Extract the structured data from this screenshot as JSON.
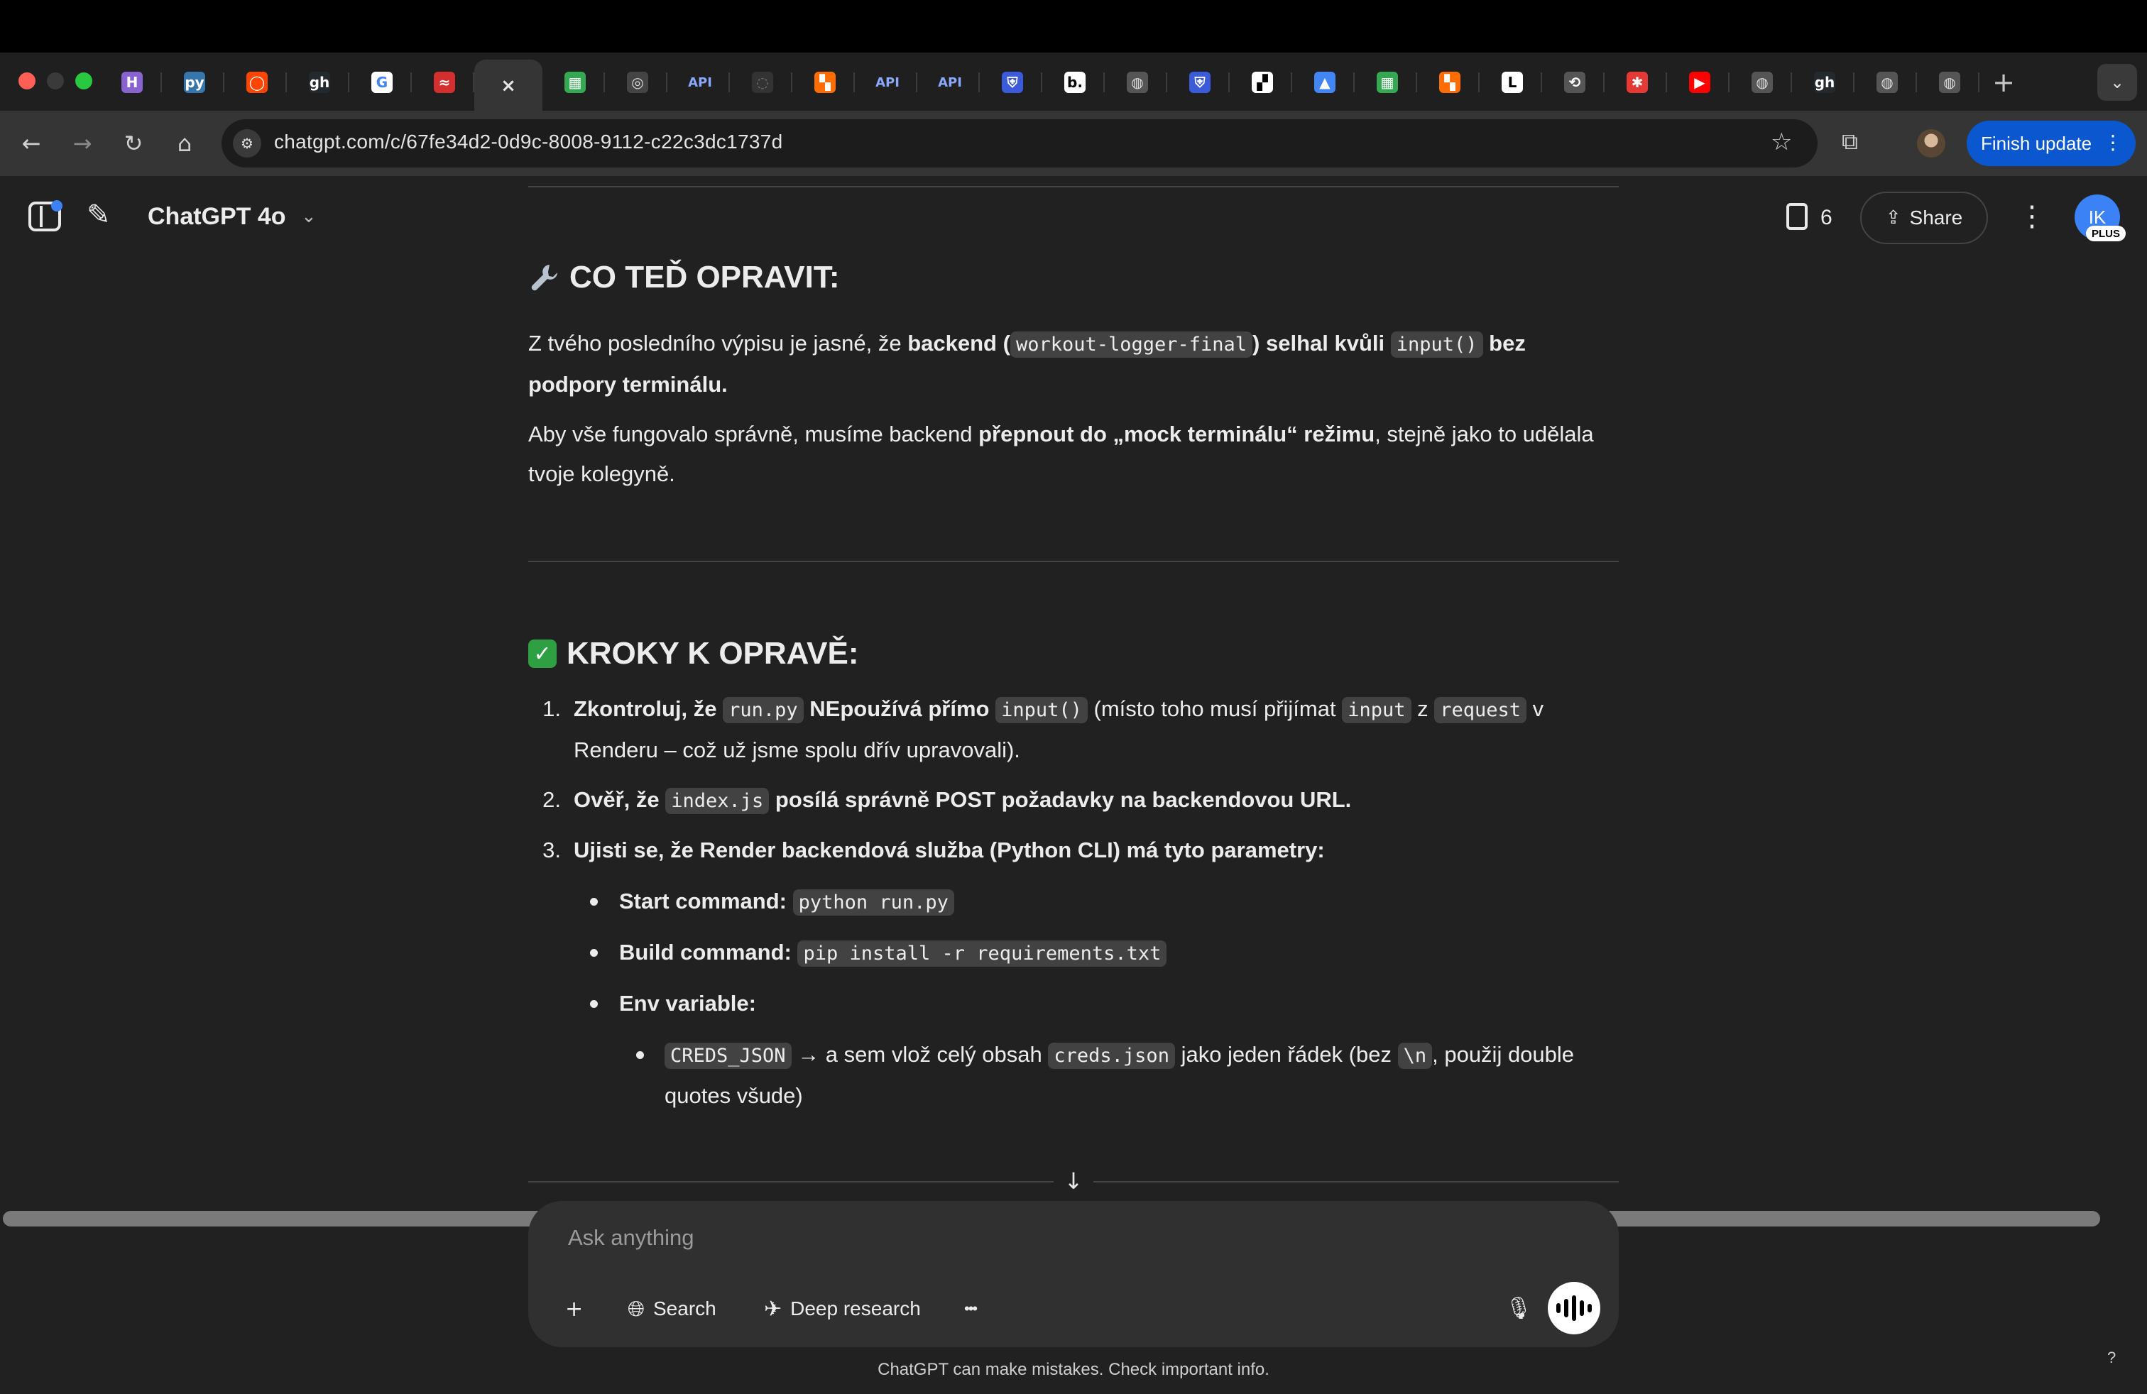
{
  "browser": {
    "active_tab_close": "×",
    "tab_favicons": [
      "H",
      "py",
      "◯",
      "gh",
      "G",
      "≈",
      "×",
      "▦",
      "◎",
      "API",
      "◌",
      "▚",
      "API",
      "API",
      "⛨",
      "b.",
      "◍",
      "⛨",
      "▞",
      "▲",
      "▦",
      "▚",
      "L",
      "⟲",
      "✱",
      "▶",
      "◍",
      "gh",
      "◍",
      "◍"
    ],
    "new_tab": "+",
    "tab_menu": "⌄",
    "url": "chatgpt.com/c/67fe34d2-0d9c-8008-9112-c22c3dc1737d",
    "finish_update": "Finish update",
    "finish_update_menu": "⋮"
  },
  "header": {
    "model": "ChatGPT 4o",
    "doc_count": "6",
    "share": "Share",
    "avatar_initials": "IK",
    "plan_badge": "PLUS"
  },
  "message": {
    "section1_title": "CO TEĎ OPRAVIT:",
    "p1_a": "Z tvého posledního výpisu je jasné, že ",
    "p1_b": "backend (",
    "p1_code1": "workout-logger-final",
    "p1_c": ") selhal kvůli ",
    "p1_code2": "input()",
    "p1_d": " bez podpory terminálu.",
    "p2_a": "Aby vše fungovalo správně, musíme backend ",
    "p2_b": "přepnout do „mock terminálu“ režimu",
    "p2_c": ", stejně jako to udělala tvoje kolegyně.",
    "section2_title": "KROKY K OPRAVĚ:",
    "step1_num": "1.",
    "step1_a": "Zkontroluj, že ",
    "step1_code1": "run.py",
    "step1_b": " NEpoužívá přímo ",
    "step1_code2": "input()",
    "step1_c": " (místo toho musí přijímat ",
    "step1_code3": "input",
    "step1_d": " z ",
    "step1_code4": "request",
    "step1_e": " v Renderu – což už jsme spolu dřív upravovali).",
    "step2_num": "2.",
    "step2_a": "Ověř, že ",
    "step2_code": "index.js",
    "step2_b": " posílá správně POST požadavky na backendovou URL.",
    "step3_num": "3.",
    "step3": "Ujisti se, že Render backendová služba (Python CLI) má tyto parametry:",
    "start_label": "Start command:",
    "start_code": "python run.py",
    "build_label": "Build command:",
    "build_code": "pip install -r requirements.txt",
    "env_label": "Env variable:",
    "env_code": "CREDS_JSON",
    "env_a": " → a sem vlož celý obsah ",
    "env_code2": "creds.json",
    "env_b": " jako jeden řádek (bez ",
    "env_code3": "\\n",
    "env_c": ", použij double quotes všude)"
  },
  "composer": {
    "placeholder": "Ask anything",
    "search": "Search",
    "deep_research": "Deep research",
    "more": "•••"
  },
  "footer": {
    "disclaimer": "ChatGPT can make mistakes. Check important info.",
    "help": "?"
  }
}
